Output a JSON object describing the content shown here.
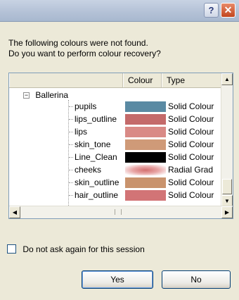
{
  "titlebar": {
    "help_label": "?",
    "close_label": "✕"
  },
  "message": {
    "line1": "The following colours were not found.",
    "line2": "Do you want to perform colour recovery?"
  },
  "list": {
    "columns": [
      "",
      "Colour",
      "Type"
    ],
    "group": {
      "expander": "−",
      "label": "Ballerina"
    },
    "rows": [
      {
        "name": "pupils",
        "color": "#5a8aa3",
        "type": "Solid Colour"
      },
      {
        "name": "lips_outline",
        "color": "#c46a6a",
        "type": "Solid Colour"
      },
      {
        "name": "lips",
        "color": "#d98a86",
        "type": "Solid Colour"
      },
      {
        "name": "skin_tone",
        "color": "#cf9a78",
        "type": "Solid Colour"
      },
      {
        "name": "Line_Clean",
        "color": "#000000",
        "type": "Solid Colour"
      },
      {
        "name": "cheeks",
        "color": "radial",
        "type": "Radial Grad"
      },
      {
        "name": "skin_outline",
        "color": "#c9936d",
        "type": "Solid Colour"
      },
      {
        "name": "hair_outline",
        "color": "#d27476",
        "type": "Solid Colour"
      }
    ],
    "scroll": {
      "up": "▲",
      "down": "▼",
      "left": "◀",
      "right": "▶"
    }
  },
  "options": {
    "dont_ask_label": "Do not ask again for this session"
  },
  "buttons": {
    "yes": "Yes",
    "no": "No"
  }
}
